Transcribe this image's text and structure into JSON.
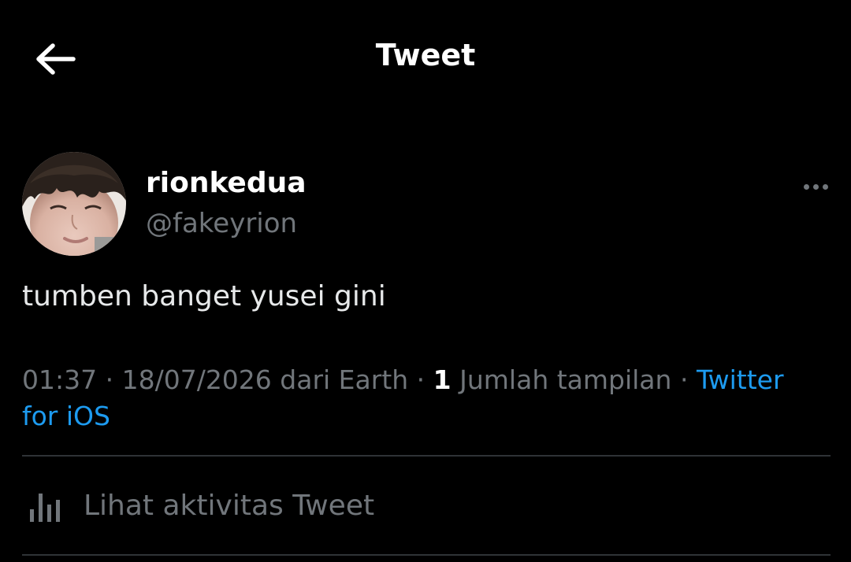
{
  "header": {
    "title": "Tweet",
    "back_icon": "arrow-left-icon"
  },
  "tweet": {
    "author": {
      "display_name": "rionkedua",
      "handle": "@fakeyrion",
      "avatar_icon": "profile-photo"
    },
    "more_icon": "more-horizontal-icon",
    "text": "tumben banget yusei gini",
    "meta": {
      "time": "01:37",
      "separator": " · ",
      "date_location": "18/07/2026 dari Earth",
      "view_count": "1",
      "view_label": " Jumlah tampilan",
      "source": "Twitter for iOS"
    },
    "activity": {
      "icon": "analytics-bar-icon",
      "label": "Lihat aktivitas Tweet"
    }
  },
  "colors": {
    "background": "#000000",
    "text_primary": "#e7e9ea",
    "text_secondary": "#71767b",
    "link": "#1d9bf0",
    "divider": "#2f3336"
  }
}
